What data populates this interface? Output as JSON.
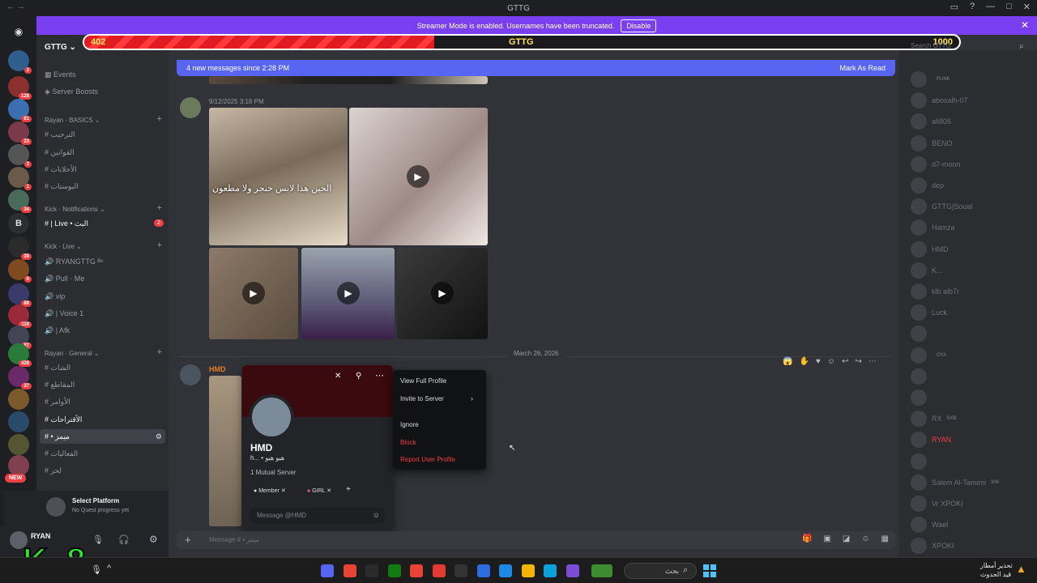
{
  "window": {
    "title": "GTTG"
  },
  "banner": {
    "text": "Streamer Mode is enabled. Usernames have been truncated.",
    "disable_label": "Disable",
    "close": "✕"
  },
  "healthbar": {
    "left_value": "402",
    "center_label": "GTTG",
    "right_value": "1000",
    "fill_fraction": 0.4
  },
  "search": {
    "placeholder": "Search GTTG"
  },
  "server": {
    "name": "GTTG ⌄"
  },
  "sidebar": {
    "events": "Events",
    "server_boosts": "Server Boosts",
    "categories": [
      {
        "name": "Rayan · BASICS ⌄",
        "channels": [
          "الترحيب",
          "القوانين",
          "الأحلانات",
          "البوستات"
        ]
      },
      {
        "name": "Kick · Notifications ⌄",
        "channels": [
          "| Live • البث"
        ]
      },
      {
        "name": "Kick · Live ⌄",
        "channels": [
          "RYANGTTG ᴮᵒ",
          "Pull · Me",
          "vip",
          "| Voice 1",
          "| Afk"
        ]
      },
      {
        "name": "Rayan · General ⌄",
        "channels": [
          "الشات",
          "المقاطع",
          "الأوامر",
          "الأقتراحات",
          "• ميمز",
          "الفعاليات",
          "لحر"
        ]
      }
    ],
    "notif_badge": "2"
  },
  "guild_badges": [
    "2",
    "128",
    "61",
    "23",
    "2",
    "1",
    "34",
    "39",
    "6",
    "89",
    "119",
    "87",
    "428",
    "37"
  ],
  "new_messages": {
    "text": "4 new messages since 2:28 PM",
    "action": "Mark As Read"
  },
  "messages": [
    {
      "timestamp": "9/12/2025 3:18 PM",
      "caption": "الحين هذا لابس خنجر ولا مطعون"
    },
    {
      "author": "HMD"
    }
  ],
  "date_divider": "March 26, 2026",
  "profile": {
    "name": "HMD",
    "status": "h... • هيو هيو",
    "mutual": "1 Mutual Server",
    "roles": [
      "Member",
      "GIRL"
    ],
    "message_placeholder": "Message @HMD"
  },
  "context_menu": {
    "items": [
      "View Full Profile",
      "Invite to Server",
      "Ignore",
      "Block",
      "Report User Profile"
    ]
  },
  "members": [
    {
      "name": "",
      "tag": "PUNK"
    },
    {
      "name": "abosalh-07"
    },
    {
      "name": "ali805"
    },
    {
      "name": "BENO"
    },
    {
      "name": "d7-moon"
    },
    {
      "name": "dep"
    },
    {
      "name": "GTTG|Soual"
    },
    {
      "name": "Hamza"
    },
    {
      "name": "HMD"
    },
    {
      "name": "K..."
    },
    {
      "name": "klb alb7r"
    },
    {
      "name": "Luck"
    },
    {
      "name": ""
    },
    {
      "name": "",
      "tag": "OYA"
    },
    {
      "name": ""
    },
    {
      "name": ""
    },
    {
      "name": "RX",
      "tag": "SXB"
    },
    {
      "name": "RYAN"
    },
    {
      "name": ""
    },
    {
      "name": "Salem Al-Tamimi",
      "tag": "306"
    },
    {
      "name": "Vr XPOKI"
    },
    {
      "name": "Wael"
    },
    {
      "name": "XPOKI"
    }
  ],
  "userbar": {
    "line1": "Select Platform",
    "line2": "No Quest progress yet",
    "username": "RYAN",
    "new_badge": "NEW"
  },
  "composer": {
    "placeholder": "Message # • ميمز"
  },
  "taskbar": {
    "search_label": "بحث",
    "news_line1": "تحذير أمطار",
    "news_line2": "قيد الحدوث"
  },
  "overlay": {
    "text": "K 8"
  },
  "colors": {
    "accent": "#5865f2",
    "streamer_banner": "#7b3ff2",
    "danger": "#f23f43"
  }
}
